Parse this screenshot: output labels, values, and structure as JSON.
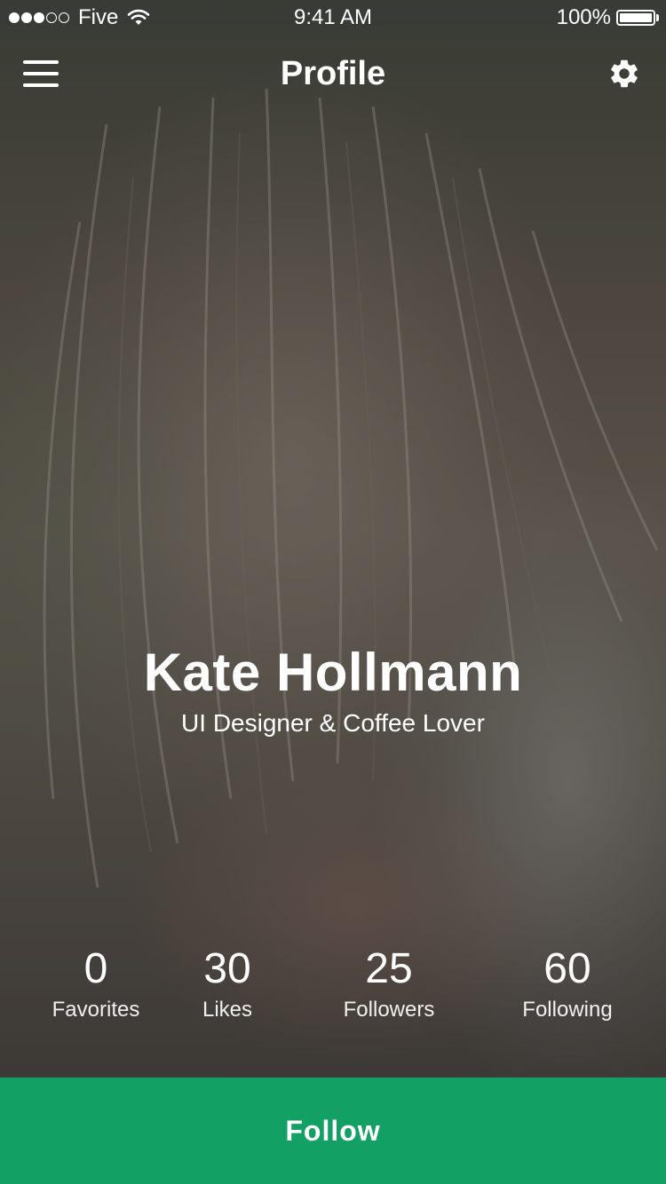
{
  "status_bar": {
    "carrier": "Five",
    "time": "9:41 AM",
    "battery": "100%",
    "signal_bars_filled": 3,
    "signal_bars_total": 5
  },
  "nav": {
    "title": "Profile",
    "menu_icon": "hamburger-menu-icon",
    "settings_icon": "gear-icon"
  },
  "profile": {
    "name": "Kate Hollmann",
    "bio": "UI Designer & Coffee Lover"
  },
  "stats": [
    {
      "value": "0",
      "label": "Favorites"
    },
    {
      "value": "30",
      "label": "Likes"
    },
    {
      "value": "25",
      "label": "Followers"
    },
    {
      "value": "60",
      "label": "Following"
    }
  ],
  "follow_button": {
    "label": "Follow"
  },
  "colors": {
    "accent": "#12a064",
    "text": "#ffffff"
  }
}
